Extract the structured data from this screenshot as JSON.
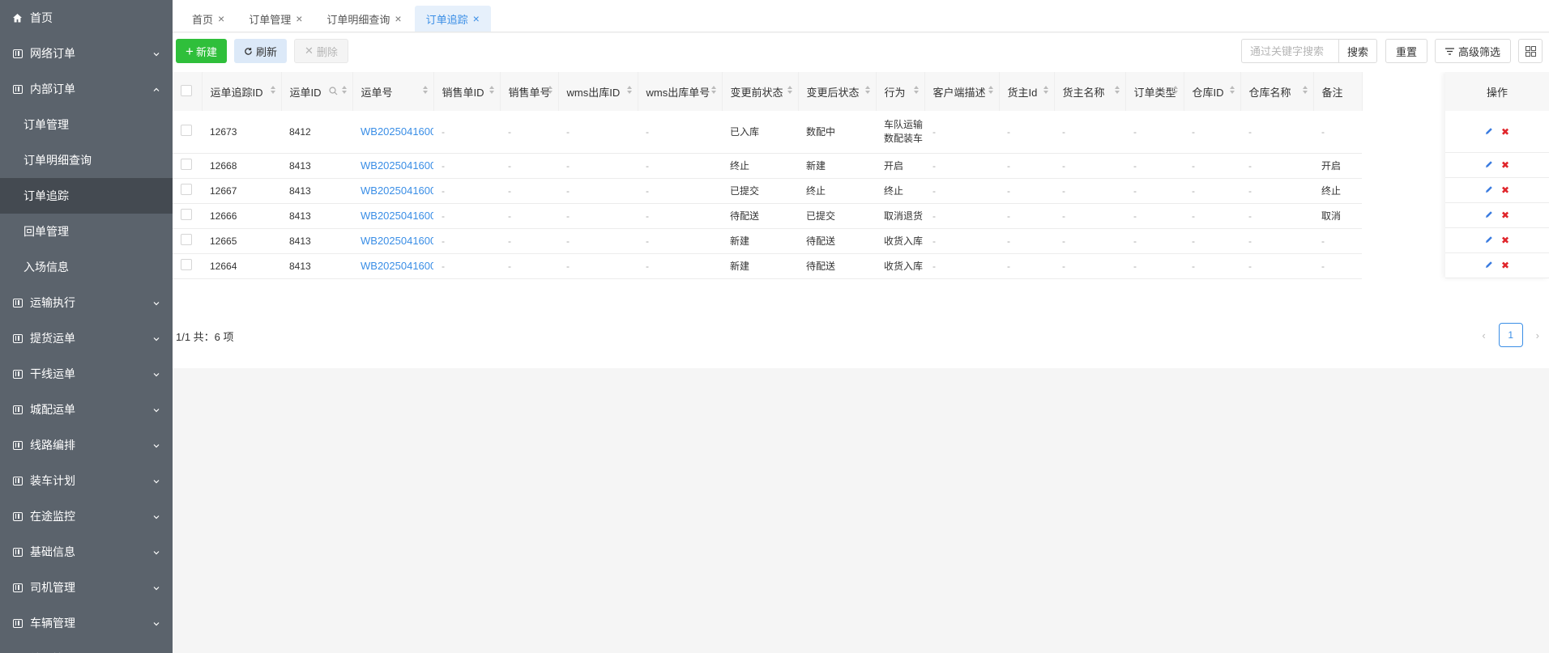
{
  "sidebar": {
    "items": [
      {
        "label": "首页",
        "icon": "home-icon",
        "expandable": false
      },
      {
        "label": "网络订单",
        "icon": "grid-icon",
        "expandable": true
      },
      {
        "label": "内部订单",
        "icon": "grid-icon",
        "expandable": true,
        "expanded": true
      }
    ],
    "subitems": [
      {
        "label": "订单管理",
        "active": false
      },
      {
        "label": "订单明细查询",
        "active": false
      },
      {
        "label": "订单追踪",
        "active": true
      },
      {
        "label": "回单管理",
        "active": false
      },
      {
        "label": "入场信息",
        "active": false
      }
    ],
    "items_after": [
      {
        "label": "运输执行"
      },
      {
        "label": "提货运单"
      },
      {
        "label": "干线运单"
      },
      {
        "label": "城配运单"
      },
      {
        "label": "线路编排"
      },
      {
        "label": "装车计划"
      },
      {
        "label": "在途监控"
      },
      {
        "label": "基础信息"
      },
      {
        "label": "司机管理"
      },
      {
        "label": "车辆管理"
      },
      {
        "label": "站点管理"
      }
    ]
  },
  "tabs": [
    {
      "label": "首页",
      "active": false
    },
    {
      "label": "订单管理",
      "active": false
    },
    {
      "label": "订单明细查询",
      "active": false
    },
    {
      "label": "订单追踪",
      "active": true
    }
  ],
  "toolbar": {
    "new_label": "新建",
    "refresh_label": "刷新",
    "delete_label": "删除",
    "search_placeholder": "通过关键字搜索",
    "search_label": "搜索",
    "reset_label": "重置",
    "advanced_label": "高级筛选"
  },
  "table": {
    "columns": [
      "运单追踪ID",
      "运单ID",
      "运单号",
      "销售单ID",
      "销售单号",
      "wms出库ID",
      "wms出库单号",
      "变更前状态",
      "变更后状态",
      "行为",
      "客户端描述",
      "货主Id",
      "货主名称",
      "订单类型",
      "仓库ID",
      "仓库名称",
      "备注"
    ],
    "ops_header": "操作",
    "rows": [
      [
        "12673",
        "8412",
        "WB20250416001",
        "-",
        "-",
        "-",
        "-",
        "已入库",
        "数配中",
        "车队运输\n数配装车",
        "-",
        "-",
        "-",
        "-",
        "-",
        "-",
        "-"
      ],
      [
        "12668",
        "8413",
        "WB20250416002",
        "-",
        "-",
        "-",
        "-",
        "终止",
        "新建",
        "开启",
        "-",
        "-",
        "-",
        "-",
        "-",
        "-",
        "开启"
      ],
      [
        "12667",
        "8413",
        "WB20250416002",
        "-",
        "-",
        "-",
        "-",
        "已提交",
        "终止",
        "终止",
        "-",
        "-",
        "-",
        "-",
        "-",
        "-",
        "终止"
      ],
      [
        "12666",
        "8413",
        "WB20250416002",
        "-",
        "-",
        "-",
        "-",
        "待配送",
        "已提交",
        "取消退货",
        "-",
        "-",
        "-",
        "-",
        "-",
        "-",
        "取消"
      ],
      [
        "12665",
        "8413",
        "WB20250416002",
        "-",
        "-",
        "-",
        "-",
        "新建",
        "待配送",
        "收货入库",
        "-",
        "-",
        "-",
        "-",
        "-",
        "-",
        "-"
      ],
      [
        "12664",
        "8413",
        "WB20250416002",
        "-",
        "-",
        "-",
        "-",
        "新建",
        "待配送",
        "收货入库",
        "-",
        "-",
        "-",
        "-",
        "-",
        "-",
        "-"
      ]
    ]
  },
  "footer": {
    "summary": "1/1 共：6 项",
    "current_page": "1"
  },
  "colors": {
    "sidebar_bg": "#5b636c",
    "active_item_bg": "#444a51",
    "accent": "#3a8ee6",
    "new_button": "#2fbf3b",
    "delete_icon": "#e0252b"
  }
}
